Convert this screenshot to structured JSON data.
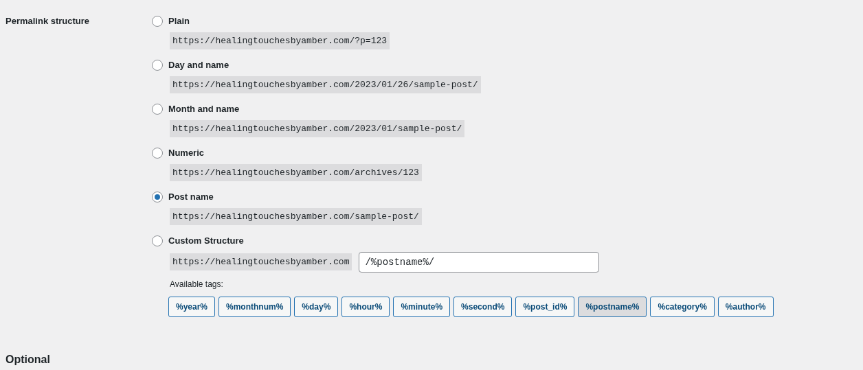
{
  "section_label": "Permalink structure",
  "options": [
    {
      "label": "Plain",
      "selected": false,
      "example": "https://healingtouchesbyamber.com/?p=123"
    },
    {
      "label": "Day and name",
      "selected": false,
      "example": "https://healingtouchesbyamber.com/2023/01/26/sample-post/"
    },
    {
      "label": "Month and name",
      "selected": false,
      "example": "https://healingtouchesbyamber.com/2023/01/sample-post/"
    },
    {
      "label": "Numeric",
      "selected": false,
      "example": "https://healingtouchesbyamber.com/archives/123"
    },
    {
      "label": "Post name",
      "selected": true,
      "example": "https://healingtouchesbyamber.com/sample-post/"
    }
  ],
  "custom": {
    "label": "Custom Structure",
    "selected": false,
    "prefix": "https://healingtouchesbyamber.com",
    "value": "/%postname%/",
    "tags_label": "Available tags:",
    "tags": [
      {
        "label": "%year%",
        "selected": false
      },
      {
        "label": "%monthnum%",
        "selected": false
      },
      {
        "label": "%day%",
        "selected": false
      },
      {
        "label": "%hour%",
        "selected": false
      },
      {
        "label": "%minute%",
        "selected": false
      },
      {
        "label": "%second%",
        "selected": false
      },
      {
        "label": "%post_id%",
        "selected": false
      },
      {
        "label": "%postname%",
        "selected": true
      },
      {
        "label": "%category%",
        "selected": false
      },
      {
        "label": "%author%",
        "selected": false
      }
    ]
  },
  "next_heading": "Optional"
}
